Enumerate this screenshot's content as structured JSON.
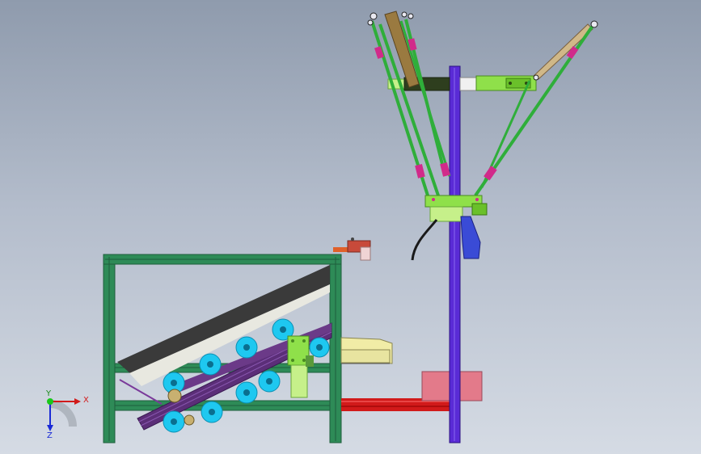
{
  "triad": {
    "x_label": "X",
    "y_label": "Y",
    "z_label": "Z"
  },
  "colors": {
    "frame": "#2e8b57",
    "frame_dark": "#1f5e3c",
    "belt": "#3a3a3a",
    "roller": "#1ec8f0",
    "post": "#5a2bd6",
    "arm": "#2fae3a",
    "joint": "#d12a8a",
    "pink_block": "#e37a8a",
    "red_rail": "#d11a1a",
    "yellow_tray": "#f1eca6",
    "lime": "#8fe04a",
    "gripper": "#3a4bd6"
  }
}
